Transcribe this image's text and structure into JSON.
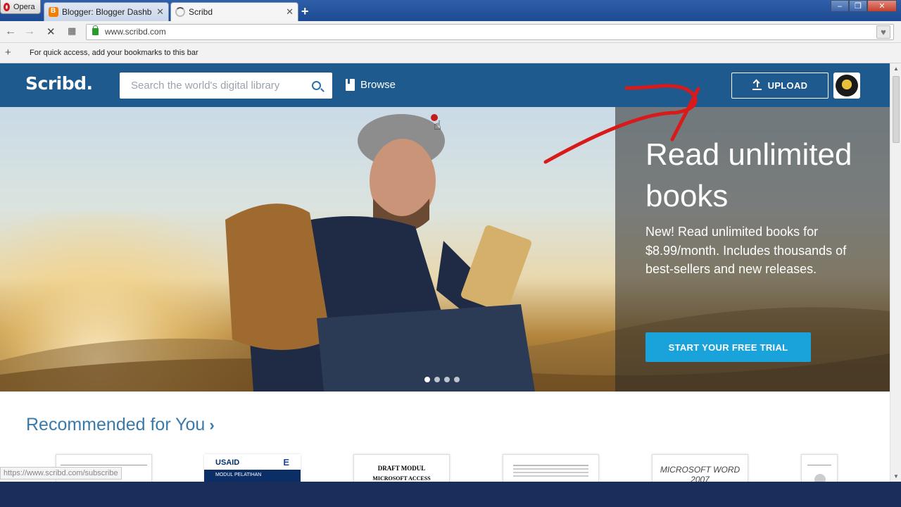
{
  "browser": {
    "opera_label": "Opera",
    "tabs": [
      {
        "title": "Blogger: Blogger Dashboard",
        "close": "✕"
      },
      {
        "title": "Scribd",
        "close": "✕"
      }
    ],
    "new_tab": "+",
    "window_controls": {
      "minimize": "–",
      "maximize": "❐",
      "close": "✕"
    },
    "url": "www.scribd.com",
    "bookmarks_message": "For quick access, add your bookmarks to this bar",
    "status_url": "https://www.scribd.com/subscribe"
  },
  "header": {
    "logo": "Scribd.",
    "search_placeholder": "Search the world's digital library",
    "browse_label": "Browse",
    "upload_label": "UPLOAD"
  },
  "hero": {
    "headline": "Read unlimited books",
    "description": "New! Read unlimited books for $8.99/month. Includes thousands of best-sellers and new releases.",
    "cta_label": "START YOUR FREE TRIAL",
    "carousel_dots": 4,
    "active_dot": 1
  },
  "recommended": {
    "title": "Recommended for You",
    "books": [
      {
        "title": ""
      },
      {
        "title": "USAID",
        "subtitle": "MODUL PELATIHAN"
      },
      {
        "title": "DRAFT MODUL",
        "subtitle": "MICROSOFT ACCESS"
      },
      {
        "title": ""
      },
      {
        "title": "MICROSOFT WORD 2007"
      },
      {
        "title": ""
      }
    ]
  },
  "colors": {
    "header": "#1e5a8d",
    "cta": "#1aa3da",
    "link": "#3a7aaa"
  }
}
